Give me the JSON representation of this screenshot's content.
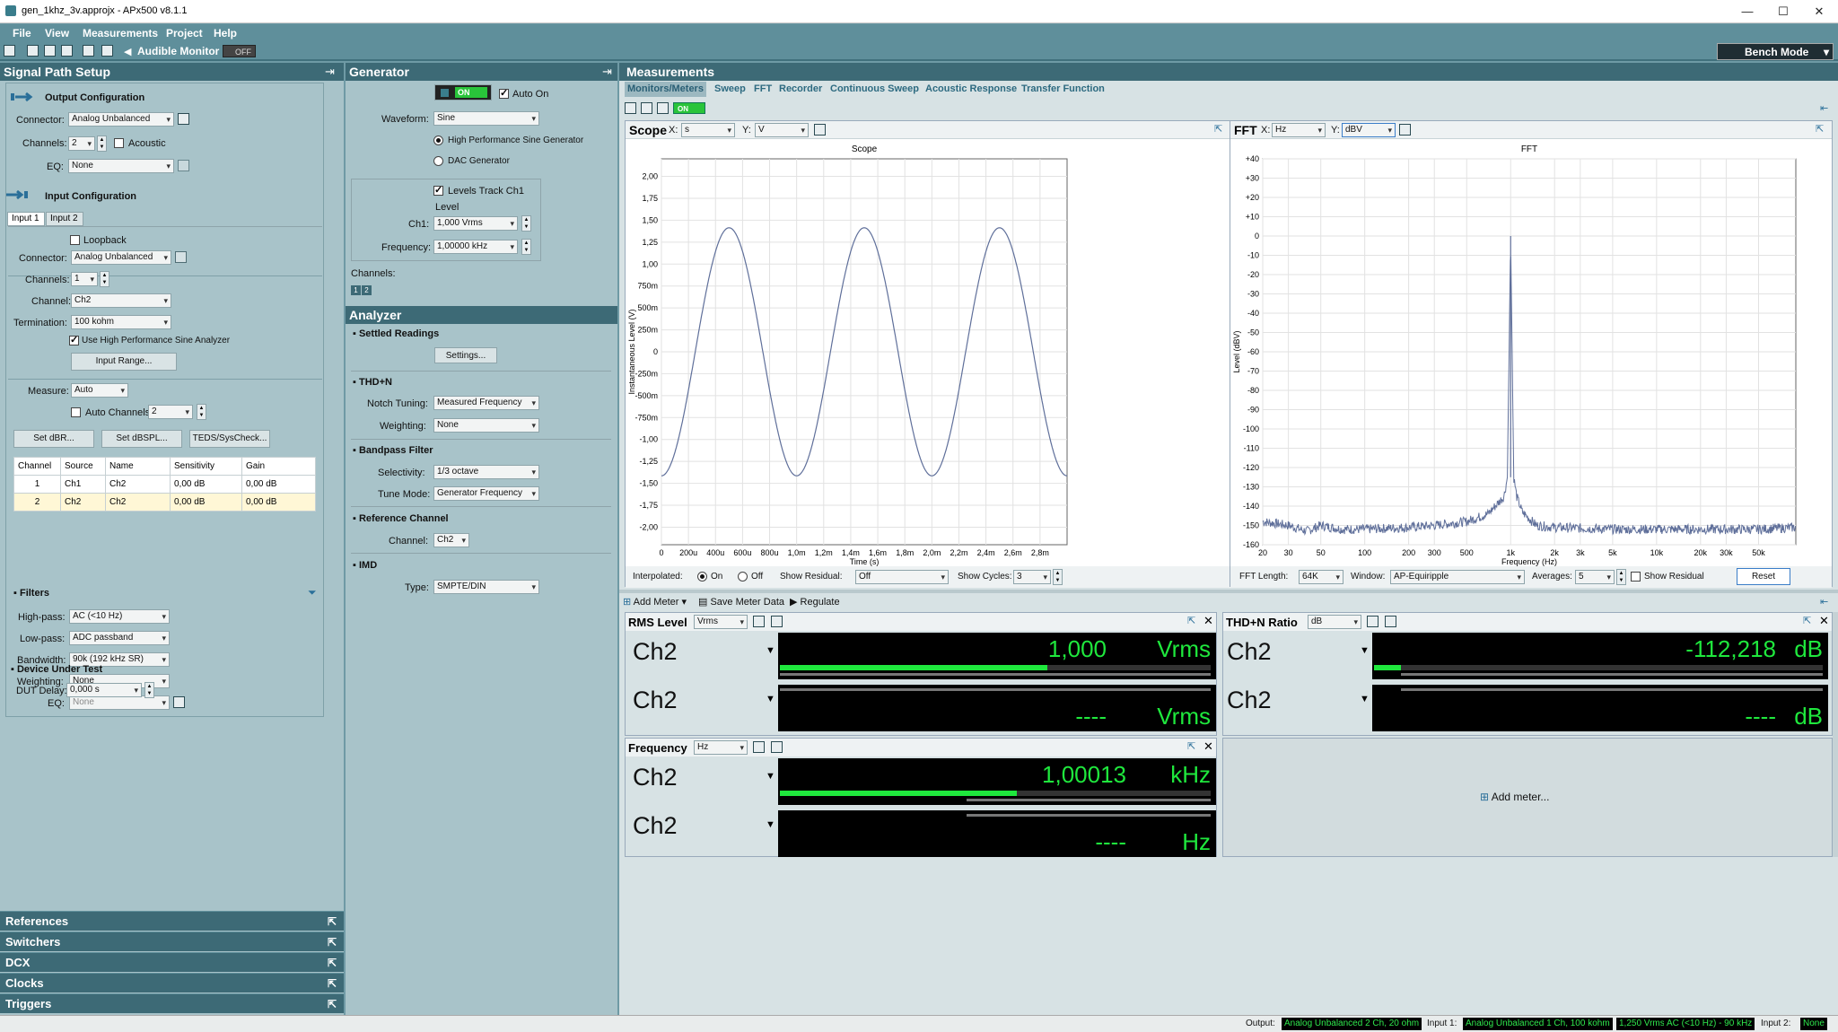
{
  "window": {
    "title": "gen_1khz_3v.approjx - APx500 v8.1.1",
    "minimize": "—",
    "maximize": "☐",
    "close": "✕"
  },
  "menu": [
    "File",
    "View",
    "Measurements",
    "Project",
    "Help"
  ],
  "toolbar": {
    "audible_monitor": "Audible Monitor",
    "audible_state": "OFF",
    "bench_mode": "Bench Mode"
  },
  "signal_path": {
    "title": "Signal Path Setup",
    "output": {
      "title": "Output Configuration",
      "connector_label": "Connector:",
      "connector": "Analog Unbalanced",
      "channels_label": "Channels:",
      "channels": "2",
      "acoustic": "Acoustic",
      "eq_label": "EQ:",
      "eq": "None"
    },
    "input": {
      "title": "Input Configuration",
      "tabs": [
        "Input 1",
        "Input 2"
      ],
      "loopback": "Loopback",
      "connector_label": "Connector:",
      "connector": "Analog Unbalanced",
      "channels_label": "Channels:",
      "channels": "1",
      "channel_label": "Channel:",
      "channel": "Ch2",
      "termination_label": "Termination:",
      "termination": "100 kohm",
      "high_perf": "Use High Performance Sine Analyzer",
      "input_range": "Input Range...",
      "measure_label": "Measure:",
      "measure": "Auto",
      "auto_channels": "Auto Channels",
      "auto_channels_value": "2",
      "set_dbr": "Set dBR...",
      "set_dbspl": "Set dBSPL...",
      "teds": "TEDS/SysCheck..."
    },
    "table": {
      "headers": [
        "Channel",
        "Source",
        "Name",
        "Sensitivity",
        "Gain"
      ],
      "rows": [
        [
          "1",
          "Ch1",
          "Ch2",
          "0,00 dB",
          "0,00 dB"
        ],
        [
          "2",
          "Ch2",
          "Ch2",
          "0,00 dB",
          "0,00 dB"
        ]
      ]
    },
    "filters": {
      "title": "Filters",
      "highpass_label": "High-pass:",
      "highpass": "AC (<10 Hz)",
      "lowpass_label": "Low-pass:",
      "lowpass": "ADC passband",
      "bandwidth_label": "Bandwidth:",
      "bandwidth": "90k (192 kHz SR)",
      "weighting_label": "Weighting:",
      "weighting": "None",
      "eq_label": "EQ:",
      "eq": "None"
    },
    "dut": {
      "title": "Device Under Test",
      "delay_label": "DUT Delay:",
      "delay": "0,000 s"
    },
    "links": [
      "References",
      "Switchers",
      "DCX",
      "Clocks",
      "Triggers"
    ]
  },
  "generator": {
    "title": "Generator",
    "on": "ON",
    "auto_on": "Auto On",
    "waveform_label": "Waveform:",
    "waveform": "Sine",
    "hp_sine": "High Performance Sine Generator",
    "dac_gen": "DAC Generator",
    "levels_track": "Levels Track Ch1",
    "level_label": "Level",
    "ch1_label": "Ch1:",
    "ch1": "1,000 Vrms",
    "freq_label": "Frequency:",
    "freq": "1,00000 kHz",
    "channels_label": "Channels:",
    "channel_btns": [
      "1",
      "2"
    ]
  },
  "analyzer": {
    "title": "Analyzer",
    "settled": "Settled Readings",
    "settings": "Settings...",
    "thdn": "THD+N",
    "notch_label": "Notch Tuning:",
    "notch": "Measured Frequency",
    "weighting_label": "Weighting:",
    "weighting": "None",
    "bandpass": "Bandpass Filter",
    "selectivity_label": "Selectivity:",
    "selectivity": "1/3 octave",
    "tune_label": "Tune Mode:",
    "tune": "Generator Frequency",
    "refch": "Reference Channel",
    "channel_label": "Channel:",
    "channel": "Ch2",
    "imd": "IMD",
    "type_label": "Type:",
    "type": "SMPTE/DIN"
  },
  "measurements": {
    "title": "Measurements",
    "tabs": [
      "Monitors/Meters",
      "Sweep",
      "FFT",
      "Recorder",
      "Continuous Sweep",
      "Acoustic Response",
      "Transfer Function"
    ],
    "on": "ON"
  },
  "scope": {
    "title": "Scope",
    "x_label": "X:",
    "x_unit": "s",
    "y_label": "Y:",
    "y_unit": "V",
    "interpolated": "Interpolated:",
    "on": "On",
    "off": "Off",
    "show_residual": "Show Residual:",
    "residual": "Off",
    "show_cycles": "Show Cycles:",
    "cycles": "3"
  },
  "fft": {
    "title": "FFT",
    "x_label": "X:",
    "x_unit": "Hz",
    "y_label": "Y:",
    "y_unit": "dBV",
    "length_label": "FFT Length:",
    "length": "64K",
    "window_label": "Window:",
    "window": "AP-Equiripple",
    "avg_label": "Averages:",
    "averages": "5",
    "show_residual": "Show Residual",
    "reset": "Reset"
  },
  "chart_data": [
    {
      "type": "line",
      "title": "Scope",
      "xlabel": "Time (s)",
      "ylabel": "Instantaneous Level (V)",
      "xlim": [
        0,
        0.003
      ],
      "ylim": [
        -2.2,
        2.2
      ],
      "x_ticks": [
        "0",
        "200u",
        "400u",
        "600u",
        "800u",
        "1,0m",
        "1,2m",
        "1,4m",
        "1,6m",
        "1,8m",
        "2,0m",
        "2,2m",
        "2,4m",
        "2,6m",
        "2,8m"
      ],
      "y_ticks": [
        "2,00",
        "1,75",
        "1,50",
        "1,25",
        "1,00",
        "750m",
        "500m",
        "250m",
        "0",
        "-250m",
        "-500m",
        "-750m",
        "-1,00",
        "-1,25",
        "-1,50",
        "-1,75",
        "-2,00"
      ],
      "series": [
        {
          "frequency_hz": 1000,
          "amplitude_v": 1.414,
          "phase_deg": -90
        }
      ]
    },
    {
      "type": "line",
      "title": "FFT",
      "xlabel": "Frequency (Hz)",
      "ylabel": "Level (dBV)",
      "x_scale": "log",
      "xlim": [
        20,
        90000
      ],
      "ylim": [
        -160,
        40
      ],
      "x_ticks": [
        "20",
        "30",
        "50",
        "100",
        "200",
        "300",
        "500",
        "1k",
        "2k",
        "3k",
        "5k",
        "10k",
        "20k",
        "30k",
        "50k"
      ],
      "y_ticks": [
        "+40",
        "+30",
        "+20",
        "+10",
        "0",
        "-10",
        "-20",
        "-30",
        "-40",
        "-50",
        "-60",
        "-70",
        "-80",
        "-90",
        "-100",
        "-110",
        "-120",
        "-130",
        "-140",
        "-150",
        "-160"
      ],
      "series": [
        {
          "x": [
            20,
            30,
            40,
            50,
            70,
            100,
            200,
            300,
            500,
            700,
            900,
            950,
            1000,
            1050,
            1100,
            1200,
            1500,
            2000,
            5000,
            10000,
            20000,
            50000,
            90000
          ],
          "y": [
            -148,
            -150,
            -153,
            -150,
            -152,
            -152,
            -151,
            -150,
            -148,
            -144,
            -135,
            -125,
            0,
            -125,
            -135,
            -143,
            -150,
            -151,
            -152,
            -152,
            -152,
            -152,
            -151
          ]
        }
      ]
    }
  ],
  "meters_toolbar": {
    "add_meter": "Add Meter",
    "save": "Save Meter Data",
    "regulate": "Regulate"
  },
  "meters": [
    {
      "title": "RMS Level",
      "unit_select": "Vrms",
      "rows": [
        {
          "ch": "Ch2",
          "value": "1,000",
          "unit": "Vrms",
          "bar": 0.62
        },
        {
          "ch": "Ch2",
          "value": "----",
          "unit": "Vrms",
          "bar": 0
        }
      ]
    },
    {
      "title": "THD+N Ratio",
      "unit_select": "dB",
      "rows": [
        {
          "ch": "Ch2",
          "value": "-112,218",
          "unit": "dB",
          "bar": 0.06
        },
        {
          "ch": "Ch2",
          "value": "----",
          "unit": "dB",
          "bar": 0
        }
      ]
    },
    {
      "title": "Frequency",
      "unit_select": "Hz",
      "rows": [
        {
          "ch": "Ch2",
          "value": "1,00013",
          "unit": "kHz",
          "bar": 0.55
        },
        {
          "ch": "Ch2",
          "value": "----",
          "unit": "Hz",
          "bar": 0
        }
      ]
    }
  ],
  "add_meter_placeholder": "Add meter...",
  "status": {
    "output_label": "Output:",
    "output": "Analog Unbalanced 2 Ch, 20 ohm",
    "input1_label": "Input 1:",
    "input1": "Analog Unbalanced 1 Ch, 100 kohm",
    "input1_range": "1,250 Vrms",
    "input1_filter": "AC (<10 Hz) - 90 kHz",
    "input2_label": "Input 2:",
    "input2": "None"
  },
  "colors": {
    "accent": "#3d6a76",
    "meter_green": "#1fe83d",
    "trace": "#5f6f9a"
  }
}
